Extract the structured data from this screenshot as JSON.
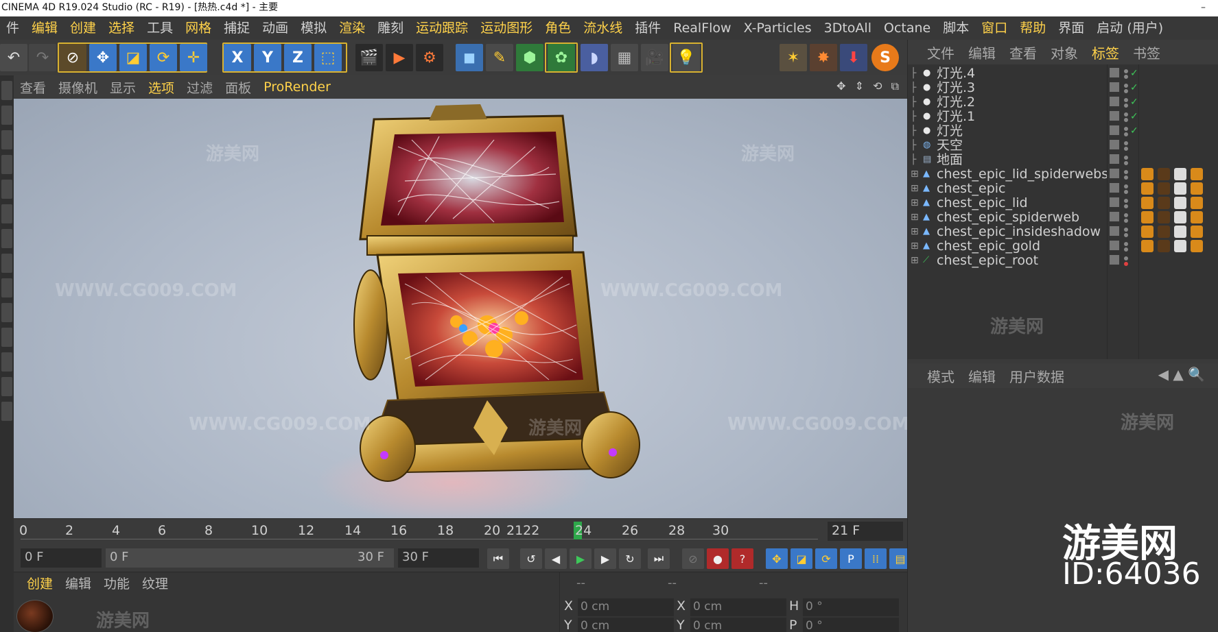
{
  "window": {
    "title": "CINEMA 4D R19.024 Studio (RC - R19) - [热热.c4d *] - 主要",
    "minimize_glyph": "–"
  },
  "menubar": {
    "items": [
      {
        "label": "件",
        "highlight": false
      },
      {
        "label": "编辑",
        "highlight": true
      },
      {
        "label": "创建",
        "highlight": true
      },
      {
        "label": "选择",
        "highlight": true
      },
      {
        "label": "工具",
        "highlight": false
      },
      {
        "label": "网格",
        "highlight": true
      },
      {
        "label": "捕捉",
        "highlight": false
      },
      {
        "label": "动画",
        "highlight": false
      },
      {
        "label": "模拟",
        "highlight": false
      },
      {
        "label": "渲染",
        "highlight": true
      },
      {
        "label": "雕刻",
        "highlight": false
      },
      {
        "label": "运动跟踪",
        "highlight": true
      },
      {
        "label": "运动图形",
        "highlight": true
      },
      {
        "label": "角色",
        "highlight": true
      },
      {
        "label": "流水线",
        "highlight": true
      },
      {
        "label": "插件",
        "highlight": false
      },
      {
        "label": "RealFlow",
        "highlight": false
      },
      {
        "label": "X-Particles",
        "highlight": false
      },
      {
        "label": "3DtoAll",
        "highlight": false
      },
      {
        "label": "Octane",
        "highlight": false
      },
      {
        "label": "脚本",
        "highlight": false
      },
      {
        "label": "窗口",
        "highlight": true
      },
      {
        "label": "帮助",
        "highlight": true
      },
      {
        "label": "界面",
        "highlight": false
      },
      {
        "label": "启动 (用户)",
        "highlight": false
      }
    ]
  },
  "toolbar": {
    "axis_x": "X",
    "axis_y": "Y",
    "axis_z": "Z",
    "render_s": "S"
  },
  "viewport": {
    "menu": [
      {
        "label": "查看",
        "highlight": false
      },
      {
        "label": "摄像机",
        "highlight": false
      },
      {
        "label": "显示",
        "highlight": false
      },
      {
        "label": "选项",
        "highlight": true
      },
      {
        "label": "过滤",
        "highlight": false
      },
      {
        "label": "面板",
        "highlight": false
      },
      {
        "label": "ProRender",
        "highlight": true
      }
    ],
    "nav_icons": "✥ ⇕ ⟲ ⧉"
  },
  "timeline": {
    "ticks": [
      "0",
      "2",
      "4",
      "6",
      "8",
      "10",
      "12",
      "14",
      "16",
      "18",
      "20",
      "2122",
      "24",
      "26",
      "28",
      "30"
    ],
    "current_frame_display": "21 F",
    "current_frame": 21
  },
  "transport": {
    "start_field": "0 F",
    "range_start": "0 F",
    "range_end": "30 F",
    "end_field": "30 F"
  },
  "material_panel": {
    "tabs": [
      {
        "label": "创建",
        "highlight": true
      },
      {
        "label": "编辑",
        "highlight": false
      },
      {
        "label": "功能",
        "highlight": false
      },
      {
        "label": "纹理",
        "highlight": false
      }
    ]
  },
  "coord_panel": {
    "header": [
      "--",
      "--",
      "--"
    ],
    "labels": {
      "x": "X",
      "y": "Y",
      "x2": "X",
      "y2": "Y",
      "h": "H",
      "p": "P"
    },
    "values": {
      "x": "0 cm",
      "y": "0 cm",
      "x2": "0 cm",
      "y2": "0 cm",
      "h": "0 °",
      "p": "0 °"
    }
  },
  "object_manager": {
    "tabs": [
      {
        "label": "文件",
        "highlight": false
      },
      {
        "label": "编辑",
        "highlight": false
      },
      {
        "label": "查看",
        "highlight": false
      },
      {
        "label": "对象",
        "highlight": false
      },
      {
        "label": "标签",
        "highlight": true
      },
      {
        "label": "书签",
        "highlight": false
      }
    ],
    "objects": [
      {
        "name": "灯光.4",
        "type": "light",
        "check": "✓"
      },
      {
        "name": "灯光.3",
        "type": "light",
        "check": "✓"
      },
      {
        "name": "灯光.2",
        "type": "light",
        "check": "✓"
      },
      {
        "name": "灯光.1",
        "type": "light",
        "check": "✓"
      },
      {
        "name": "灯光",
        "type": "light",
        "check": "✓"
      },
      {
        "name": "天空",
        "type": "sky",
        "check": ""
      },
      {
        "name": "地面",
        "type": "floor",
        "check": ""
      },
      {
        "name": "chest_epic_lid_spiderwebs",
        "type": "mesh",
        "check": ""
      },
      {
        "name": "chest_epic",
        "type": "mesh",
        "check": ""
      },
      {
        "name": "chest_epic_lid",
        "type": "mesh",
        "check": ""
      },
      {
        "name": "chest_epic_spiderweb",
        "type": "mesh",
        "check": ""
      },
      {
        "name": "chest_epic_insideshadow",
        "type": "mesh",
        "check": ""
      },
      {
        "name": "chest_epic_gold",
        "type": "mesh",
        "check": ""
      },
      {
        "name": "chest_epic_root",
        "type": "bone",
        "check": ""
      }
    ]
  },
  "attribute_manager": {
    "tabs": [
      "模式",
      "编辑",
      "用户数据"
    ]
  },
  "overlay": {
    "brand": "游美网",
    "id": "ID:64036",
    "watermark_cn": "游美网",
    "watermark_url": "WWW.CG009.COM"
  },
  "colors": {
    "accent": "#ffd24a",
    "check_green": "#3ec85a",
    "playhead": "#2ea84a"
  }
}
